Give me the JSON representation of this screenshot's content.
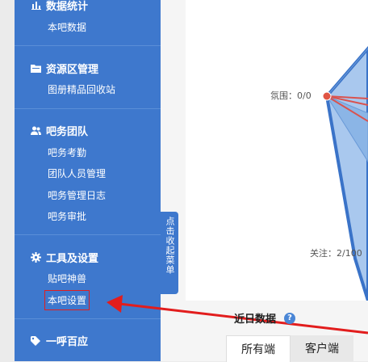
{
  "sidebar": {
    "sections": [
      {
        "title": "数据统计",
        "icon": "bar-chart-icon",
        "items": [
          "本吧数据"
        ]
      },
      {
        "title": "资源区管理",
        "icon": "folder-icon",
        "items": [
          "图册精品回收站"
        ]
      },
      {
        "title": "吧务团队",
        "icon": "users-icon",
        "items": [
          "吧务考勤",
          "团队人员管理",
          "吧务管理日志",
          "吧务审批"
        ]
      },
      {
        "title": "工具及设置",
        "icon": "gear-icon",
        "items": [
          "贴吧神兽",
          "本吧设置"
        ]
      },
      {
        "title": "一呼百应",
        "icon": "tag-icon",
        "items": []
      }
    ],
    "collapse_label": "点击收起菜单"
  },
  "radar": {
    "label_atmosphere": "氛围：0/0",
    "label_follow": "关注：2/100"
  },
  "recent": {
    "title": "近日数据",
    "help": "?"
  },
  "tabs": [
    "所有端",
    "客户端"
  ],
  "colors": {
    "sidebar": "#3e78cd",
    "highlight": "#e21d1d",
    "radar_fill": "#a9c8ee",
    "radar_stroke": "#3a73c8"
  }
}
